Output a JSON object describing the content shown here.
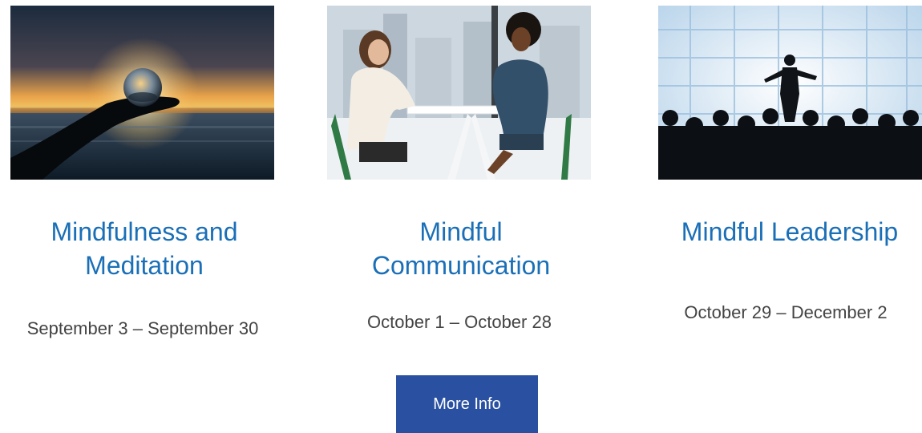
{
  "courses": [
    {
      "title": "Mindfulness and Meditation",
      "dates": "September 3 – September 30"
    },
    {
      "title": "Mindful Communication",
      "dates": "October 1 – October 28"
    },
    {
      "title": "Mindful Leadership",
      "dates": "October 29 – December 2"
    }
  ],
  "cta": {
    "label": "More Info"
  },
  "colors": {
    "title": "#1a6fb7",
    "button": "#2a50a1",
    "date_text": "#444444"
  }
}
